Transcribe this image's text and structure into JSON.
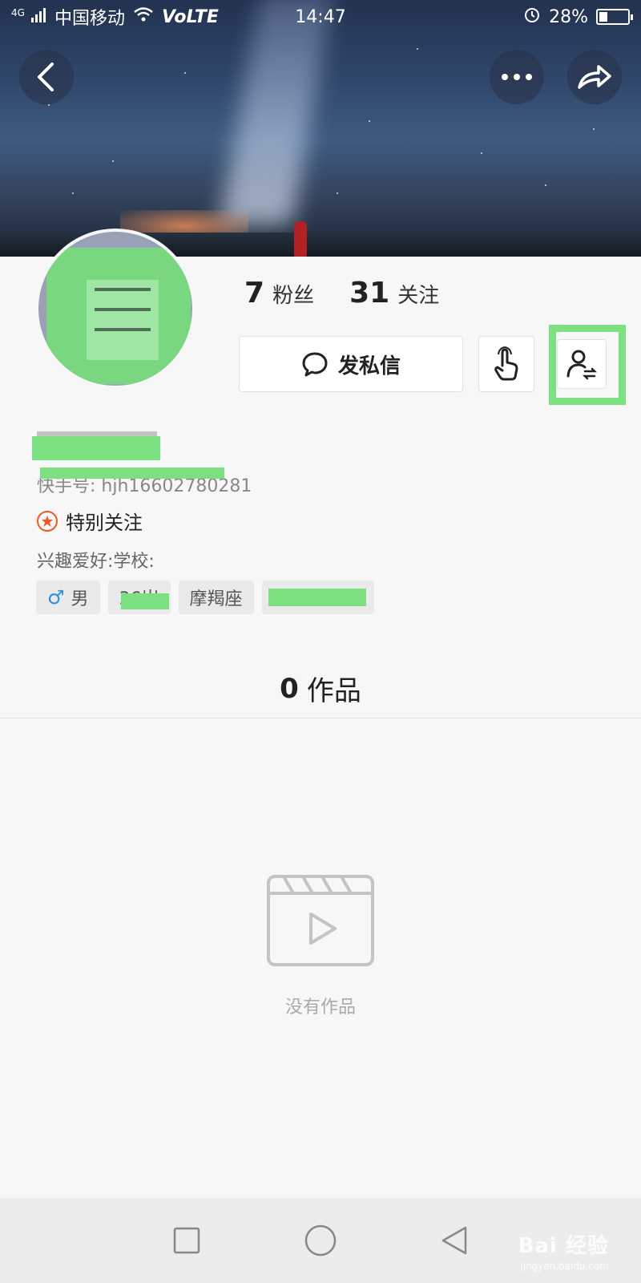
{
  "status_bar": {
    "network": "4G",
    "carrier": "中国移动",
    "volte": "VoLTE",
    "time": "14:47",
    "battery": "28%"
  },
  "profile": {
    "followers_count": "7",
    "followers_label": "粉丝",
    "following_count": "31",
    "following_label": "关注",
    "message_button_label": "发私信",
    "kuaishou_id": "快手号: hjh16602780281",
    "special_follow_label": "特别关注",
    "interests": "兴趣爱好:学校:",
    "tags": {
      "gender_label": "男",
      "age_label": "36岁",
      "zodiac_label": "摩羯座"
    }
  },
  "works": {
    "count": "0",
    "label": "作品",
    "empty_text": "没有作品"
  },
  "watermark": {
    "brand": "Bai 经验",
    "url": "jingyan.baidu.com"
  },
  "colors": {
    "highlight_green": "#7be07f",
    "star_orange": "#ee5a24",
    "male_blue": "#2a8fe0"
  },
  "icons": [
    "back-arrow-icon",
    "more-icon",
    "share-icon",
    "message-bubble-icon",
    "poke-hand-icon",
    "user-switch-icon",
    "star-badge-icon",
    "male-icon",
    "video-clapper-icon",
    "nav-recent-icon",
    "nav-home-icon",
    "nav-back-icon"
  ]
}
